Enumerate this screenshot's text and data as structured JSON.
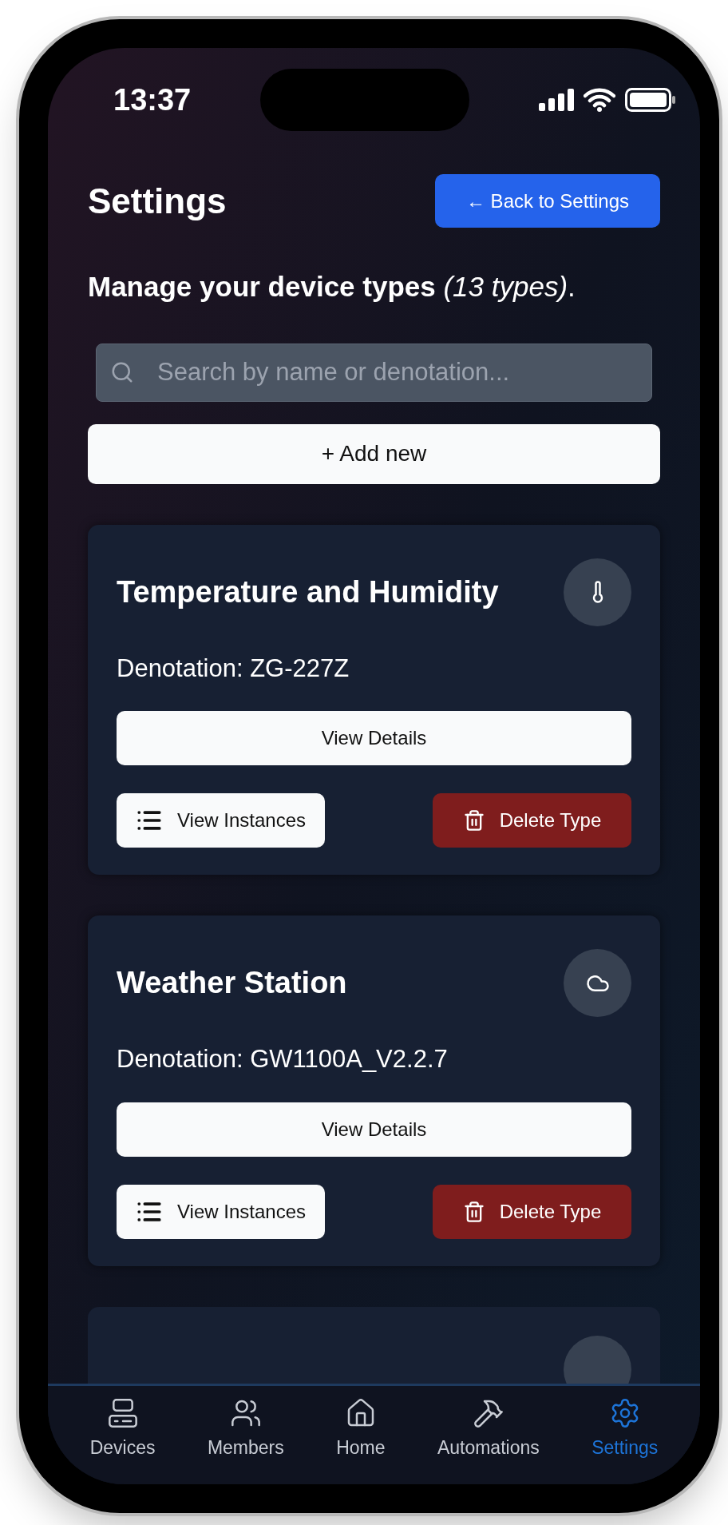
{
  "status_bar": {
    "time": "13:37"
  },
  "header": {
    "title": "Settings",
    "back_button": "← Back to Settings"
  },
  "subtitle": "**Manage your device types** *(13 types)*.",
  "search": {
    "placeholder": "Search by name or denotation..."
  },
  "add_button": "+ Add new",
  "device_types": [
    {
      "name": "Temperature and Humidity",
      "kind": "thermometer",
      "denotation": "Denotation: ZG-227Z",
      "details_button": "View Details",
      "instances_button": "View Instances",
      "delete_button": "Delete Type"
    },
    {
      "name": "Weather Station",
      "kind": "cloud",
      "denotation": "Denotation: GW1100A_V2.2.7",
      "details_button": "View Details",
      "instances_button": "View Instances",
      "delete_button": "Delete Type"
    }
  ],
  "tab_bar": [
    {
      "label": "Devices",
      "kind": "devices",
      "selected": false
    },
    {
      "label": "Members",
      "kind": "members",
      "selected": false
    },
    {
      "label": "Home",
      "kind": "home",
      "selected": false
    },
    {
      "label": "Automations",
      "kind": "hammer",
      "selected": false
    },
    {
      "label": "Settings",
      "kind": "settings",
      "selected": true
    }
  ]
}
